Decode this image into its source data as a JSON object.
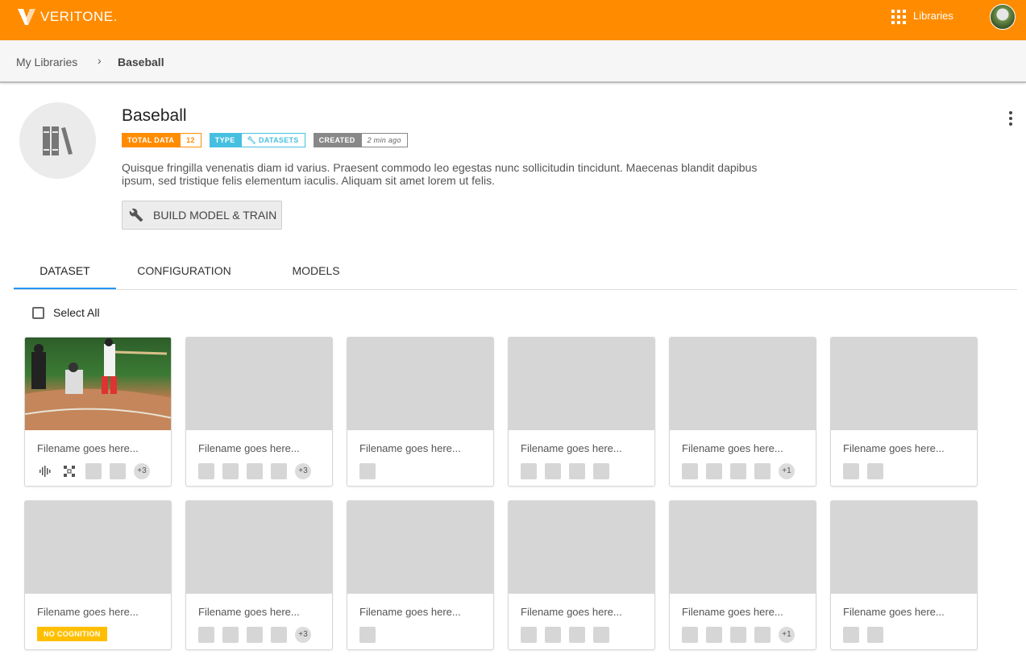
{
  "topbar": {
    "brand": "VERITONE.",
    "libraries_label": "Libraries"
  },
  "breadcrumb": {
    "root": "My Libraries",
    "separator": "›",
    "current": "Baseball"
  },
  "library": {
    "title": "Baseball",
    "badges": {
      "total_key": "TOTAL DATA",
      "total_value": "12",
      "type_key": "TYPE",
      "type_value": "DATASETS",
      "created_key": "CREATED",
      "created_value": "2 min ago"
    },
    "description": "Quisque fringilla venenatis diam id varius. Praesent commodo leo egestas nunc sollicitudin tincidunt. Maecenas blandit dapibus ipsum, sed tristique felis elementum iaculis. Aliquam sit amet lorem ut felis.",
    "build_button": "BUILD MODEL & TRAIN"
  },
  "tabs": [
    {
      "label": "DATASET",
      "active": true
    },
    {
      "label": "CONFIGURATION",
      "active": false
    },
    {
      "label": "MODELS",
      "active": false
    }
  ],
  "select_all": "Select All",
  "cards": [
    {
      "filename": "Filename goes here...",
      "more": "+3",
      "no_cognition": ""
    },
    {
      "filename": "Filename goes here...",
      "more": "+3"
    },
    {
      "filename": "Filename goes here...",
      "more": ""
    },
    {
      "filename": "Filename goes here...",
      "more": ""
    },
    {
      "filename": "Filename goes here...",
      "more": "+1"
    },
    {
      "filename": "Filename goes here...",
      "more": ""
    },
    {
      "filename": "Filename goes here...",
      "no_cognition": "NO COGNITION"
    },
    {
      "filename": "Filename goes here...",
      "more": "+3"
    },
    {
      "filename": "Filename goes here...",
      "more": ""
    },
    {
      "filename": "Filename goes here...",
      "more": ""
    },
    {
      "filename": "Filename goes here...",
      "more": "+1"
    },
    {
      "filename": "Filename goes here...",
      "more": ""
    }
  ],
  "colors": {
    "brand": "#ff8c00",
    "type_badge": "#46bfe0",
    "active_tab": "#2196f3",
    "no_cognition": "#ffbf00"
  }
}
